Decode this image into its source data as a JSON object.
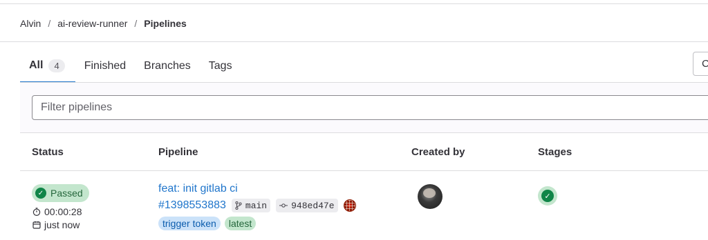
{
  "breadcrumb": {
    "items": [
      "Alvin",
      "ai-review-runner"
    ],
    "current": "Pipelines"
  },
  "tabs": [
    {
      "label": "All",
      "count": "4"
    },
    {
      "label": "Finished"
    },
    {
      "label": "Branches"
    },
    {
      "label": "Tags"
    }
  ],
  "toolbar": {
    "right_button_label": "C"
  },
  "filter": {
    "placeholder": "Filter pipelines",
    "value": ""
  },
  "table": {
    "headers": {
      "status": "Status",
      "pipeline": "Pipeline",
      "created_by": "Created by",
      "stages": "Stages"
    },
    "rows": [
      {
        "status": "Passed",
        "duration": "00:00:28",
        "finished": "just now",
        "commit_title": "feat: init gitlab ci",
        "pipeline_id": "#1398553883",
        "branch": "main",
        "commit_sha": "948ed47e",
        "badges": [
          "trigger token",
          "latest"
        ]
      }
    ]
  },
  "icons": {
    "status": "check-circle-icon",
    "duration": "timer-icon",
    "finished": "calendar-icon",
    "branch": "branch-icon",
    "commit": "commit-icon",
    "stage": "check-circle-icon"
  },
  "colors": {
    "accent": "#1f75cb",
    "success": "#108548",
    "success_bg": "#c3e6cd",
    "badge_blue_bg": "#cbe2f9"
  }
}
